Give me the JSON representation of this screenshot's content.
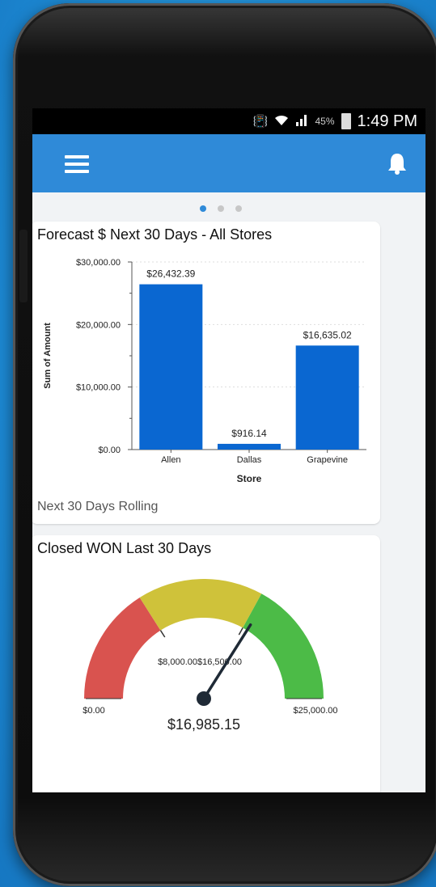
{
  "status_bar": {
    "battery": "45%",
    "time": "1:49 PM"
  },
  "carousel": {
    "pages": 3,
    "active": 0
  },
  "card1": {
    "title": "Forecast $ Next 30 Days - All Stores",
    "footer": "Next 30 Days Rolling"
  },
  "card2": {
    "title": "Closed WON Last 30 Days"
  },
  "chart_data": [
    {
      "type": "bar",
      "title": "Forecast $ Next 30 Days - All Stores",
      "xlabel": "Store",
      "ylabel": "Sum of Amount",
      "categories": [
        "Allen",
        "Dallas",
        "Grapevine"
      ],
      "values": [
        26432.39,
        916.14,
        16635.02
      ],
      "value_labels": [
        "$26,432.39",
        "$916.14",
        "$16,635.02"
      ],
      "ylim": [
        0,
        30000
      ],
      "y_ticks": [
        0,
        10000,
        20000,
        30000
      ],
      "y_tick_labels": [
        "$0.00",
        "$10,000.00",
        "$20,000.00",
        "$30,000.00"
      ],
      "bar_color": "#0a67d1",
      "grid": true
    },
    {
      "type": "gauge",
      "title": "Closed WON Last 30 Days",
      "value": 16985.15,
      "value_label": "$16,985.15",
      "min": 0,
      "max": 25000,
      "min_label": "$0.00",
      "max_label": "$25,000.00",
      "thresholds": [
        8000,
        16500
      ],
      "threshold_labels": [
        "$8,000.00",
        "$16,500.00"
      ],
      "segment_colors": [
        "#d9534f",
        "#cfc23a",
        "#4cbb47"
      ]
    }
  ]
}
